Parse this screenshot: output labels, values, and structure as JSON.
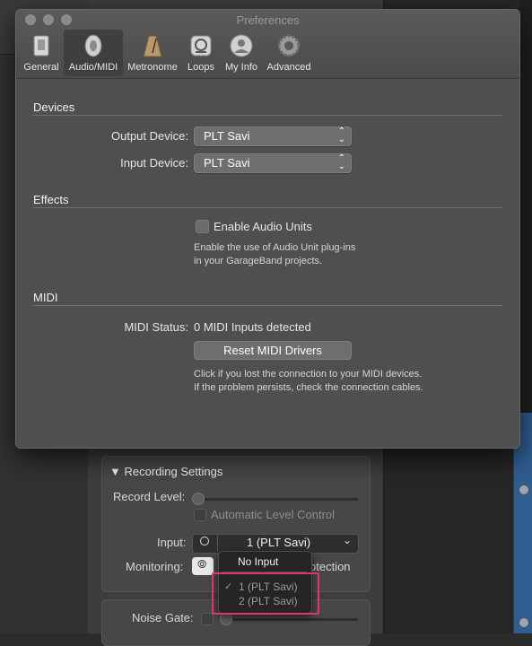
{
  "window": {
    "title": "Preferences"
  },
  "toolbar": {
    "items": [
      {
        "label": "General",
        "icon": "general-icon"
      },
      {
        "label": "Audio/MIDI",
        "icon": "speaker-icon",
        "selected": true
      },
      {
        "label": "Metronome",
        "icon": "metronome-icon"
      },
      {
        "label": "Loops",
        "icon": "loops-icon"
      },
      {
        "label": "My Info",
        "icon": "user-icon"
      },
      {
        "label": "Advanced",
        "icon": "gear-icon"
      }
    ]
  },
  "devices": {
    "heading": "Devices",
    "output_label": "Output Device:",
    "output_value": "PLT Savi",
    "input_label": "Input Device:",
    "input_value": "PLT Savi"
  },
  "effects": {
    "heading": "Effects",
    "checkbox_label": "Enable Audio Units",
    "checked": false,
    "help_line1": "Enable the use of Audio Unit plug-ins",
    "help_line2": "in your GarageBand projects."
  },
  "midi": {
    "heading": "MIDI",
    "status_label": "MIDI Status:",
    "status_value": "0 MIDI Inputs detected",
    "reset_button": "Reset MIDI Drivers",
    "help_line1": "Click if you lost the connection to your MIDI devices.",
    "help_line2": "If the problem persists, check the connection cables."
  },
  "recording": {
    "heading": "Recording Settings",
    "record_level_label": "Record Level:",
    "auto_level_label": "Automatic Level Control",
    "input_label": "Input:",
    "input_value": "1  (PLT Savi)",
    "monitoring_label": "Monitoring:",
    "monitoring_trailing_text": "otection",
    "noise_gate_label": "Noise Gate:"
  },
  "input_menu": {
    "no_input": "No Input",
    "items": [
      "1  (PLT Savi)",
      "2  (PLT Savi)"
    ],
    "checked_index": 0,
    "checkmark": "✓"
  },
  "colors": {
    "highlight": "#e0336f",
    "window_bg": "#4f4f4f",
    "blue_panel": "#2f5d8f"
  }
}
